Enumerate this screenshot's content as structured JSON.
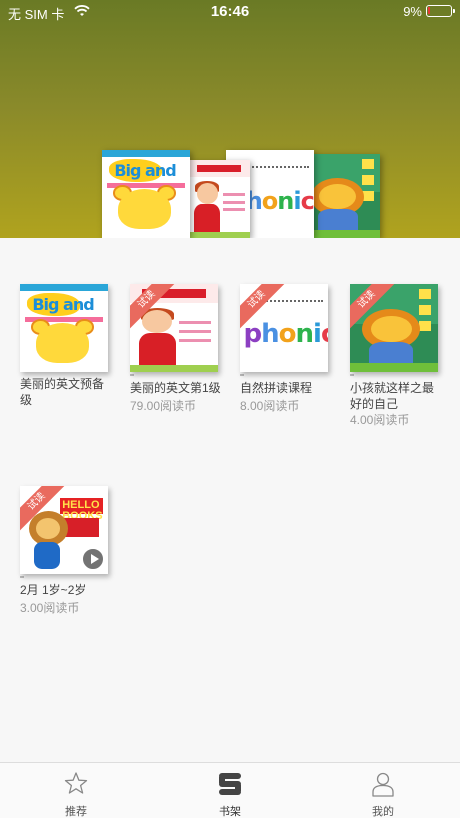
{
  "status_bar": {
    "carrier": "无 SIM 卡",
    "time": "16:46",
    "battery": "9%",
    "battery_level": 0.09
  },
  "books": [
    {
      "title": "美丽的英文预备级",
      "price": "",
      "trial": false,
      "cover": "big-and",
      "cover_text": "Big and"
    },
    {
      "title": "美丽的英文第1级",
      "price": "79.00阅读币",
      "trial": true,
      "cover": "level1"
    },
    {
      "title": "自然拼读课程",
      "price": "8.00阅读币",
      "trial": true,
      "cover": "phonics",
      "cover_text": "phonics"
    },
    {
      "title": "小孩就这样之最好的自己",
      "price": "4.00阅读币",
      "trial": true,
      "cover": "lion"
    },
    {
      "title": "2月 1岁~2岁",
      "price": "3.00阅读币",
      "trial": true,
      "cover": "hello",
      "cover_text": "HELLO BOOKS"
    }
  ],
  "trial_label": "试读",
  "tabs": [
    {
      "label": "推荐",
      "icon": "star-icon",
      "active": false
    },
    {
      "label": "书架",
      "icon": "bookshelf-icon",
      "active": true
    },
    {
      "label": "我的",
      "icon": "profile-icon",
      "active": false
    }
  ]
}
